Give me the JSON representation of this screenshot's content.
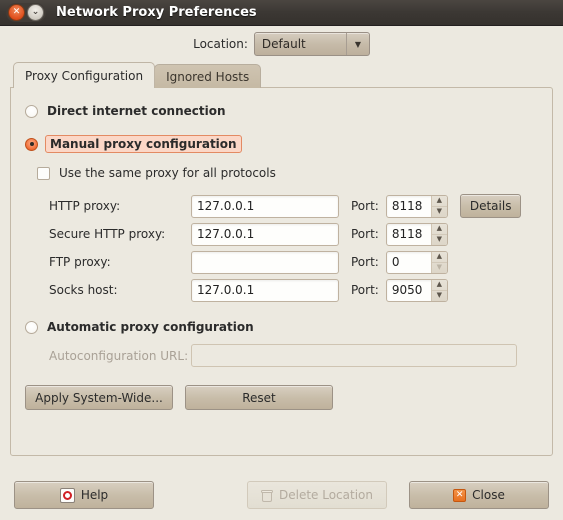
{
  "window": {
    "title": "Network Proxy Preferences",
    "close_icon": "close-circle-icon",
    "close_glyph": "✕",
    "menu_icon": "chevron-down-circle-icon",
    "menu_glyph": "⌄"
  },
  "location": {
    "label": "Location:",
    "selected": "Default",
    "arrow_glyph": "▼",
    "options": [
      "Default"
    ]
  },
  "tabs": [
    {
      "label": "Proxy Configuration",
      "active": true
    },
    {
      "label": "Ignored Hosts",
      "active": false
    }
  ],
  "options": {
    "direct": {
      "label": "Direct internet connection",
      "selected": false
    },
    "manual": {
      "label": "Manual proxy configuration",
      "selected": true,
      "focused": true
    },
    "same_proxy": {
      "label": "Use the same proxy for all protocols",
      "checked": false
    },
    "automatic": {
      "label": "Automatic proxy configuration",
      "selected": false
    }
  },
  "proxy_fields": [
    {
      "label": "HTTP proxy:",
      "host": "127.0.0.1",
      "host_placeholder": "",
      "port_label": "Port:",
      "port": "8118",
      "up_enabled": true,
      "down_enabled": true
    },
    {
      "label": "Secure HTTP proxy:",
      "host": "127.0.0.1",
      "host_placeholder": "",
      "port_label": "Port:",
      "port": "8118",
      "up_enabled": true,
      "down_enabled": true
    },
    {
      "label": "FTP proxy:",
      "host": "",
      "host_placeholder": "",
      "port_label": "Port:",
      "port": "0",
      "up_enabled": true,
      "down_enabled": false
    },
    {
      "label": "Socks host:",
      "host": "127.0.0.1",
      "host_placeholder": "",
      "port_label": "Port:",
      "port": "9050",
      "up_enabled": true,
      "down_enabled": true
    }
  ],
  "details_button": "Details",
  "autoconfig": {
    "label": "Autoconfiguration URL:",
    "value": "",
    "placeholder": "",
    "disabled": true
  },
  "actions": {
    "apply": "Apply System-Wide...",
    "reset": "Reset"
  },
  "bottom": {
    "help": {
      "label": "Help",
      "icon": "help-lifebuoy-icon",
      "disabled": false
    },
    "delete": {
      "label": "Delete Location",
      "icon": "trash-icon",
      "disabled": true
    },
    "close": {
      "label": "Close",
      "icon": "close-x-icon",
      "glyph": "✕",
      "disabled": false
    }
  },
  "spinner_glyphs": {
    "up": "▲",
    "down": "▼"
  },
  "colors": {
    "window_bg": "#ece9e0",
    "titlebar": "#3c3834",
    "accent_orange": "#ef6c35",
    "focus_highlight": "#fbd7c7",
    "button_face": "#c8bda9",
    "entry_bg": "#fefefc",
    "disabled_text": "#a9a196"
  }
}
